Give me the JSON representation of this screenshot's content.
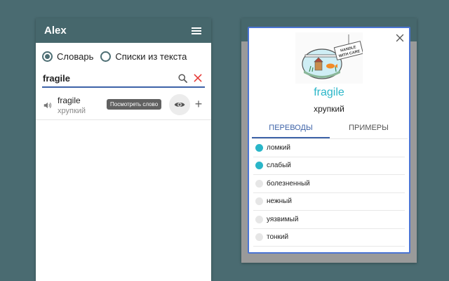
{
  "left": {
    "header_title": "Alex",
    "radio_dictionary": "Словарь",
    "radio_text_lists": "Списки из текста",
    "search_value": "fragile",
    "result": {
      "word": "fragile",
      "translation": "хрупкий",
      "tooltip": "Посмотреть слово",
      "plus": "+"
    }
  },
  "dialog": {
    "image_caption": "HANDLE WITH CARE",
    "word": "fragile",
    "translation": "хрупкий",
    "tabs": [
      "ПЕРЕВОДЫ",
      "ПРИМЕРЫ"
    ],
    "options": [
      {
        "label": "ломкий",
        "selected": true
      },
      {
        "label": "слабый",
        "selected": true
      },
      {
        "label": "болезненный",
        "selected": false
      },
      {
        "label": "нежный",
        "selected": false
      },
      {
        "label": "уязвимый",
        "selected": false
      },
      {
        "label": "тонкий",
        "selected": false
      }
    ]
  },
  "colors": {
    "header": "#46676c",
    "accent": "#3e63a8",
    "teal": "#2ab6c8",
    "background": "#4a6b71",
    "clear": "#e53935"
  },
  "icons": [
    "menu-icon",
    "search-icon",
    "clear-icon",
    "speaker-icon",
    "eye-icon",
    "plus-icon",
    "close-icon"
  ]
}
